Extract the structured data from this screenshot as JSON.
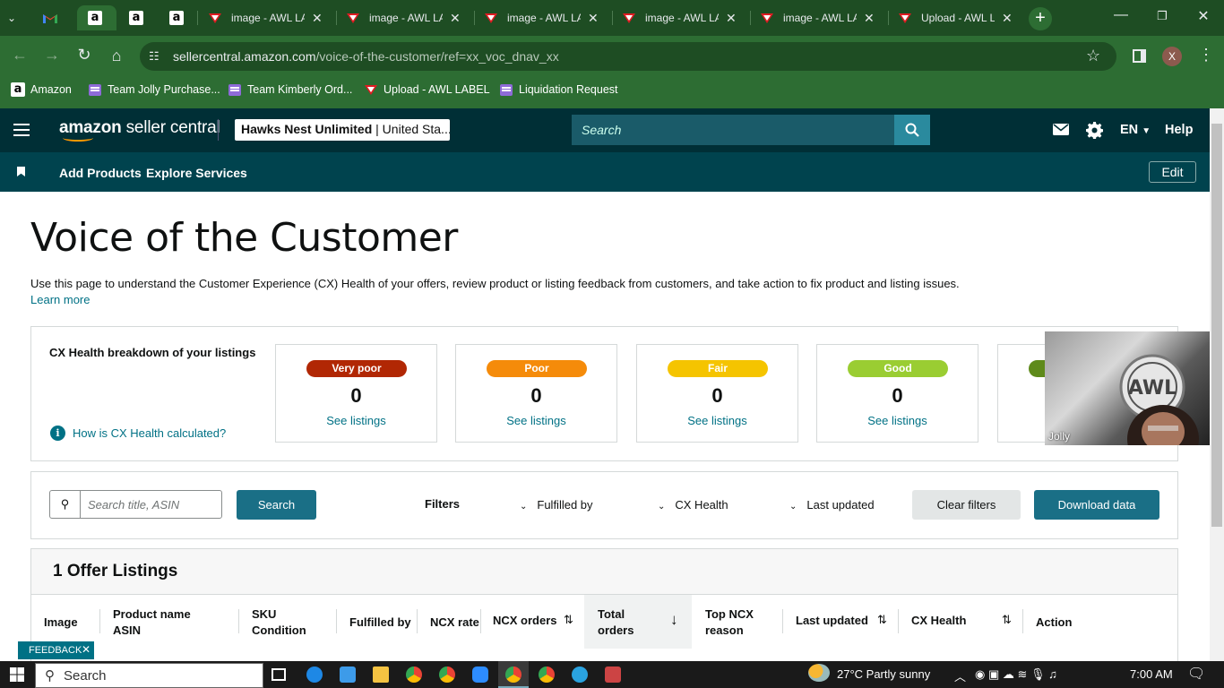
{
  "browser": {
    "tabs": [
      {
        "title": "",
        "icon": "gmail-icon"
      },
      {
        "title": "",
        "icon": "amazon-icon",
        "active": true
      },
      {
        "title": "",
        "icon": "amazon-icon"
      },
      {
        "title": "",
        "icon": "amazon-icon"
      },
      {
        "title": "image - AWL LA",
        "icon": "awl-label-icon"
      },
      {
        "title": "image - AWL LA",
        "icon": "awl-label-icon"
      },
      {
        "title": "image - AWL LA",
        "icon": "awl-label-icon"
      },
      {
        "title": "image - AWL LA",
        "icon": "awl-label-icon"
      },
      {
        "title": "image - AWL LA",
        "icon": "awl-label-icon"
      },
      {
        "title": "Upload - AWL L",
        "icon": "awl-label-icon"
      }
    ],
    "url_host": "sellercentral.amazon.com",
    "url_path": "/voice-of-the-customer/ref=xx_voc_dnav_xx",
    "profile_initial": "X",
    "bookmarks": [
      {
        "label": "Amazon",
        "icon": "amazon-icon"
      },
      {
        "label": "Team Jolly Purchase...",
        "icon": "list-icon"
      },
      {
        "label": "Team Kimberly Ord...",
        "icon": "list-icon"
      },
      {
        "label": "Upload - AWL LABEL",
        "icon": "awl-label-icon"
      },
      {
        "label": "Liquidation Request",
        "icon": "list-icon"
      }
    ]
  },
  "header": {
    "logo_bold": "amazon",
    "logo_rest": " seller central",
    "store_name": "Hawks Nest Unlimited",
    "store_region": " | United Sta...",
    "search_placeholder": "Search",
    "lang": "EN",
    "help": "Help",
    "colors": {
      "header_bg": "#002f36",
      "nav_bg": "#00434e",
      "accent": "#1a6f86"
    }
  },
  "subnav": {
    "links": [
      "Add Products",
      "Explore Services"
    ],
    "edit": "Edit"
  },
  "page": {
    "title": "Voice of the Customer",
    "intro": "Use this page to understand the Customer Experience (CX) Health of your offers, review product or listing feedback from customers, and take action to fix product and listing issues.",
    "learn_more": "Learn more"
  },
  "cx_health": {
    "title": "CX Health breakdown of your listings",
    "how_link": "How is CX Health calculated?",
    "cards": [
      {
        "label": "Very poor",
        "count": "0",
        "link": "See listings",
        "color": "#b12704",
        "text_color": "#ffffff"
      },
      {
        "label": "Poor",
        "count": "0",
        "link": "See listings",
        "color": "#f58b0a",
        "text_color": "#ffffff"
      },
      {
        "label": "Fair",
        "count": "0",
        "link": "See listings",
        "color": "#f5c400",
        "text_color": "#ffffff"
      },
      {
        "label": "Good",
        "count": "0",
        "link": "See listings",
        "color": "#9acd32",
        "text_color": "#ffffff"
      },
      {
        "label": "",
        "count": "",
        "link": "",
        "color": "#5e8a1a",
        "text_color": "#ffffff"
      }
    ]
  },
  "video_overlay": {
    "name": "Jolly"
  },
  "filters": {
    "search_placeholder": "Search title, ASIN",
    "search_button": "Search",
    "filters_label": "Filters",
    "dropdowns": [
      "Fulfilled by",
      "CX Health",
      "Last updated"
    ],
    "clear": "Clear filters",
    "download": "Download data"
  },
  "table": {
    "title": "1 Offer Listings",
    "columns": [
      {
        "line1": "Image",
        "line2": ""
      },
      {
        "line1": "Product name",
        "line2": "ASIN"
      },
      {
        "line1": "SKU",
        "line2": "Condition"
      },
      {
        "line1": "Fulfilled by",
        "line2": ""
      },
      {
        "line1": "NCX rate",
        "line2": ""
      },
      {
        "line1": "NCX orders",
        "line2": ""
      },
      {
        "line1": "Total",
        "line2": "orders"
      },
      {
        "line1": "Top NCX",
        "line2": "reason"
      },
      {
        "line1": "Last updated",
        "line2": ""
      },
      {
        "line1": "CX Health",
        "line2": ""
      },
      {
        "line1": "Action",
        "line2": ""
      }
    ]
  },
  "feedback": "FEEDBACK",
  "taskbar": {
    "search": "Search",
    "weather": "27°C  Partly sunny",
    "time": "7:00 AM"
  }
}
